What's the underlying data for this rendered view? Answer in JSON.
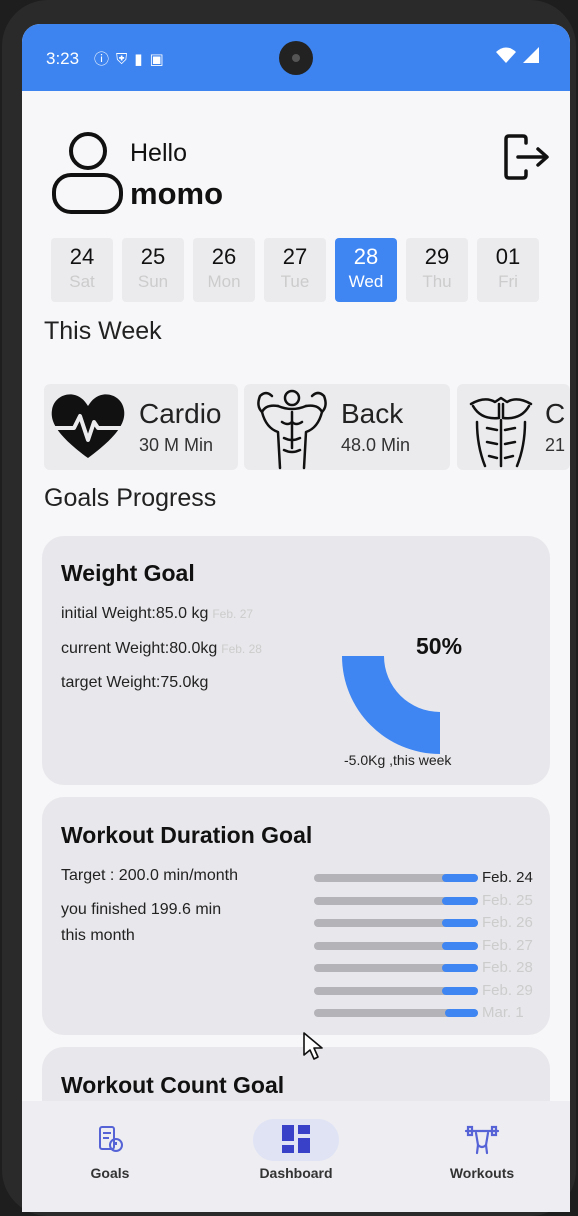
{
  "status_bar": {
    "time": "3:23",
    "icons": [
      "info-icon",
      "shield-icon",
      "sd-card-icon",
      "a-icon"
    ],
    "right_icons": [
      "wifi-icon",
      "signal-icon"
    ]
  },
  "header": {
    "greeting": "Hello",
    "username": "momo"
  },
  "days": [
    {
      "num": "24",
      "day": "Sat",
      "selected": false
    },
    {
      "num": "25",
      "day": "Sun",
      "selected": false
    },
    {
      "num": "26",
      "day": "Mon",
      "selected": false
    },
    {
      "num": "27",
      "day": "Tue",
      "selected": false
    },
    {
      "num": "28",
      "day": "Wed",
      "selected": true
    },
    {
      "num": "29",
      "day": "Thu",
      "selected": false
    },
    {
      "num": "01",
      "day": "Fri",
      "selected": false
    }
  ],
  "this_week": {
    "title": "This Week",
    "cards": [
      {
        "name": "Cardio",
        "value": "30 M Min",
        "icon": "heartbeat-icon"
      },
      {
        "name": "Back",
        "value": "48.0 Min",
        "icon": "back-muscles-icon"
      },
      {
        "name": "C",
        "value": "21",
        "icon": "chest-muscles-icon"
      }
    ]
  },
  "goals_progress": {
    "title": "Goals Progress",
    "weight_goal": {
      "title": "Weight Goal",
      "initial_label": "initial Weight:85.0 kg",
      "initial_date": "Feb. 27",
      "current_label": "current Weight:80.0kg",
      "current_date": "Feb. 28",
      "target_label": "target Weight:75.0kg",
      "percent_text": "50%",
      "progress_fraction": 0.5,
      "week_change": "-5.0Kg ,this week"
    },
    "workout_duration_goal": {
      "title": "Workout Duration Goal",
      "target": "Target : 200.0 min/month",
      "finished_line1": "you finished 199.6 min",
      "finished_line2": "this month",
      "rows": [
        {
          "date": "Feb. 24",
          "fill": 0.22
        },
        {
          "date": "Feb. 25",
          "fill": 0.22
        },
        {
          "date": "Feb. 26",
          "fill": 0.22
        },
        {
          "date": "Feb. 27",
          "fill": 0.22
        },
        {
          "date": "Feb. 28",
          "fill": 0.22
        },
        {
          "date": "Feb. 29",
          "fill": 0.22
        },
        {
          "date": "Mar. 1",
          "fill": 0.2
        }
      ]
    },
    "workout_count_goal": {
      "title": "Workout Count Goal"
    }
  },
  "bottom_nav": [
    {
      "label": "Goals",
      "icon": "goals-icon",
      "active": false
    },
    {
      "label": "Dashboard",
      "icon": "dashboard-icon",
      "active": true
    },
    {
      "label": "Workouts",
      "icon": "workouts-icon",
      "active": false
    }
  ],
  "colors": {
    "accent": "#3f86f2",
    "status_bar": "#3d84f0",
    "card": "#e8e8ec",
    "bar_track": "#b4b4b8"
  }
}
